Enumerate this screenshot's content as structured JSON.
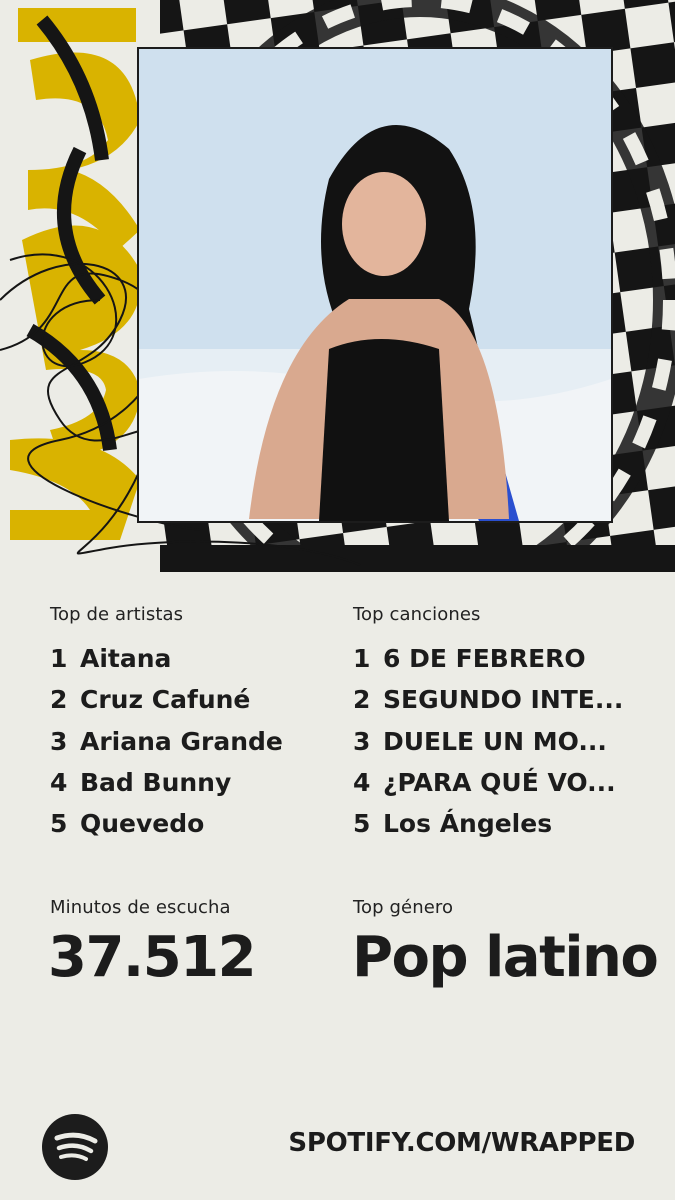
{
  "header": {
    "year": "2025"
  },
  "top_artists": {
    "label": "Top de artistas",
    "items": [
      {
        "rank": "1",
        "name": "Aitana"
      },
      {
        "rank": "2",
        "name": "Cruz Cafuné"
      },
      {
        "rank": "3",
        "name": "Ariana Grande"
      },
      {
        "rank": "4",
        "name": "Bad Bunny"
      },
      {
        "rank": "5",
        "name": "Quevedo"
      }
    ]
  },
  "top_songs": {
    "label": "Top canciones",
    "items": [
      {
        "rank": "1",
        "name": "6 DE FEBRERO"
      },
      {
        "rank": "2",
        "name": "SEGUNDO INTE..."
      },
      {
        "rank": "3",
        "name": "DUELE UN MO..."
      },
      {
        "rank": "4",
        "name": "¿PARA QUÉ VO..."
      },
      {
        "rank": "5",
        "name": "Los Ángeles"
      }
    ]
  },
  "stats": {
    "minutes_label": "Minutos de escucha",
    "minutes_value": "37.512",
    "genre_label": "Top género",
    "genre_value": "Pop latino"
  },
  "footer": {
    "url": "SPOTIFY.COM/WRAPPED",
    "logo_icon": "spotify-logo-icon"
  },
  "colors": {
    "background": "#ecece6",
    "accent_yellow": "#d9b300",
    "text": "#1c1c1c"
  }
}
